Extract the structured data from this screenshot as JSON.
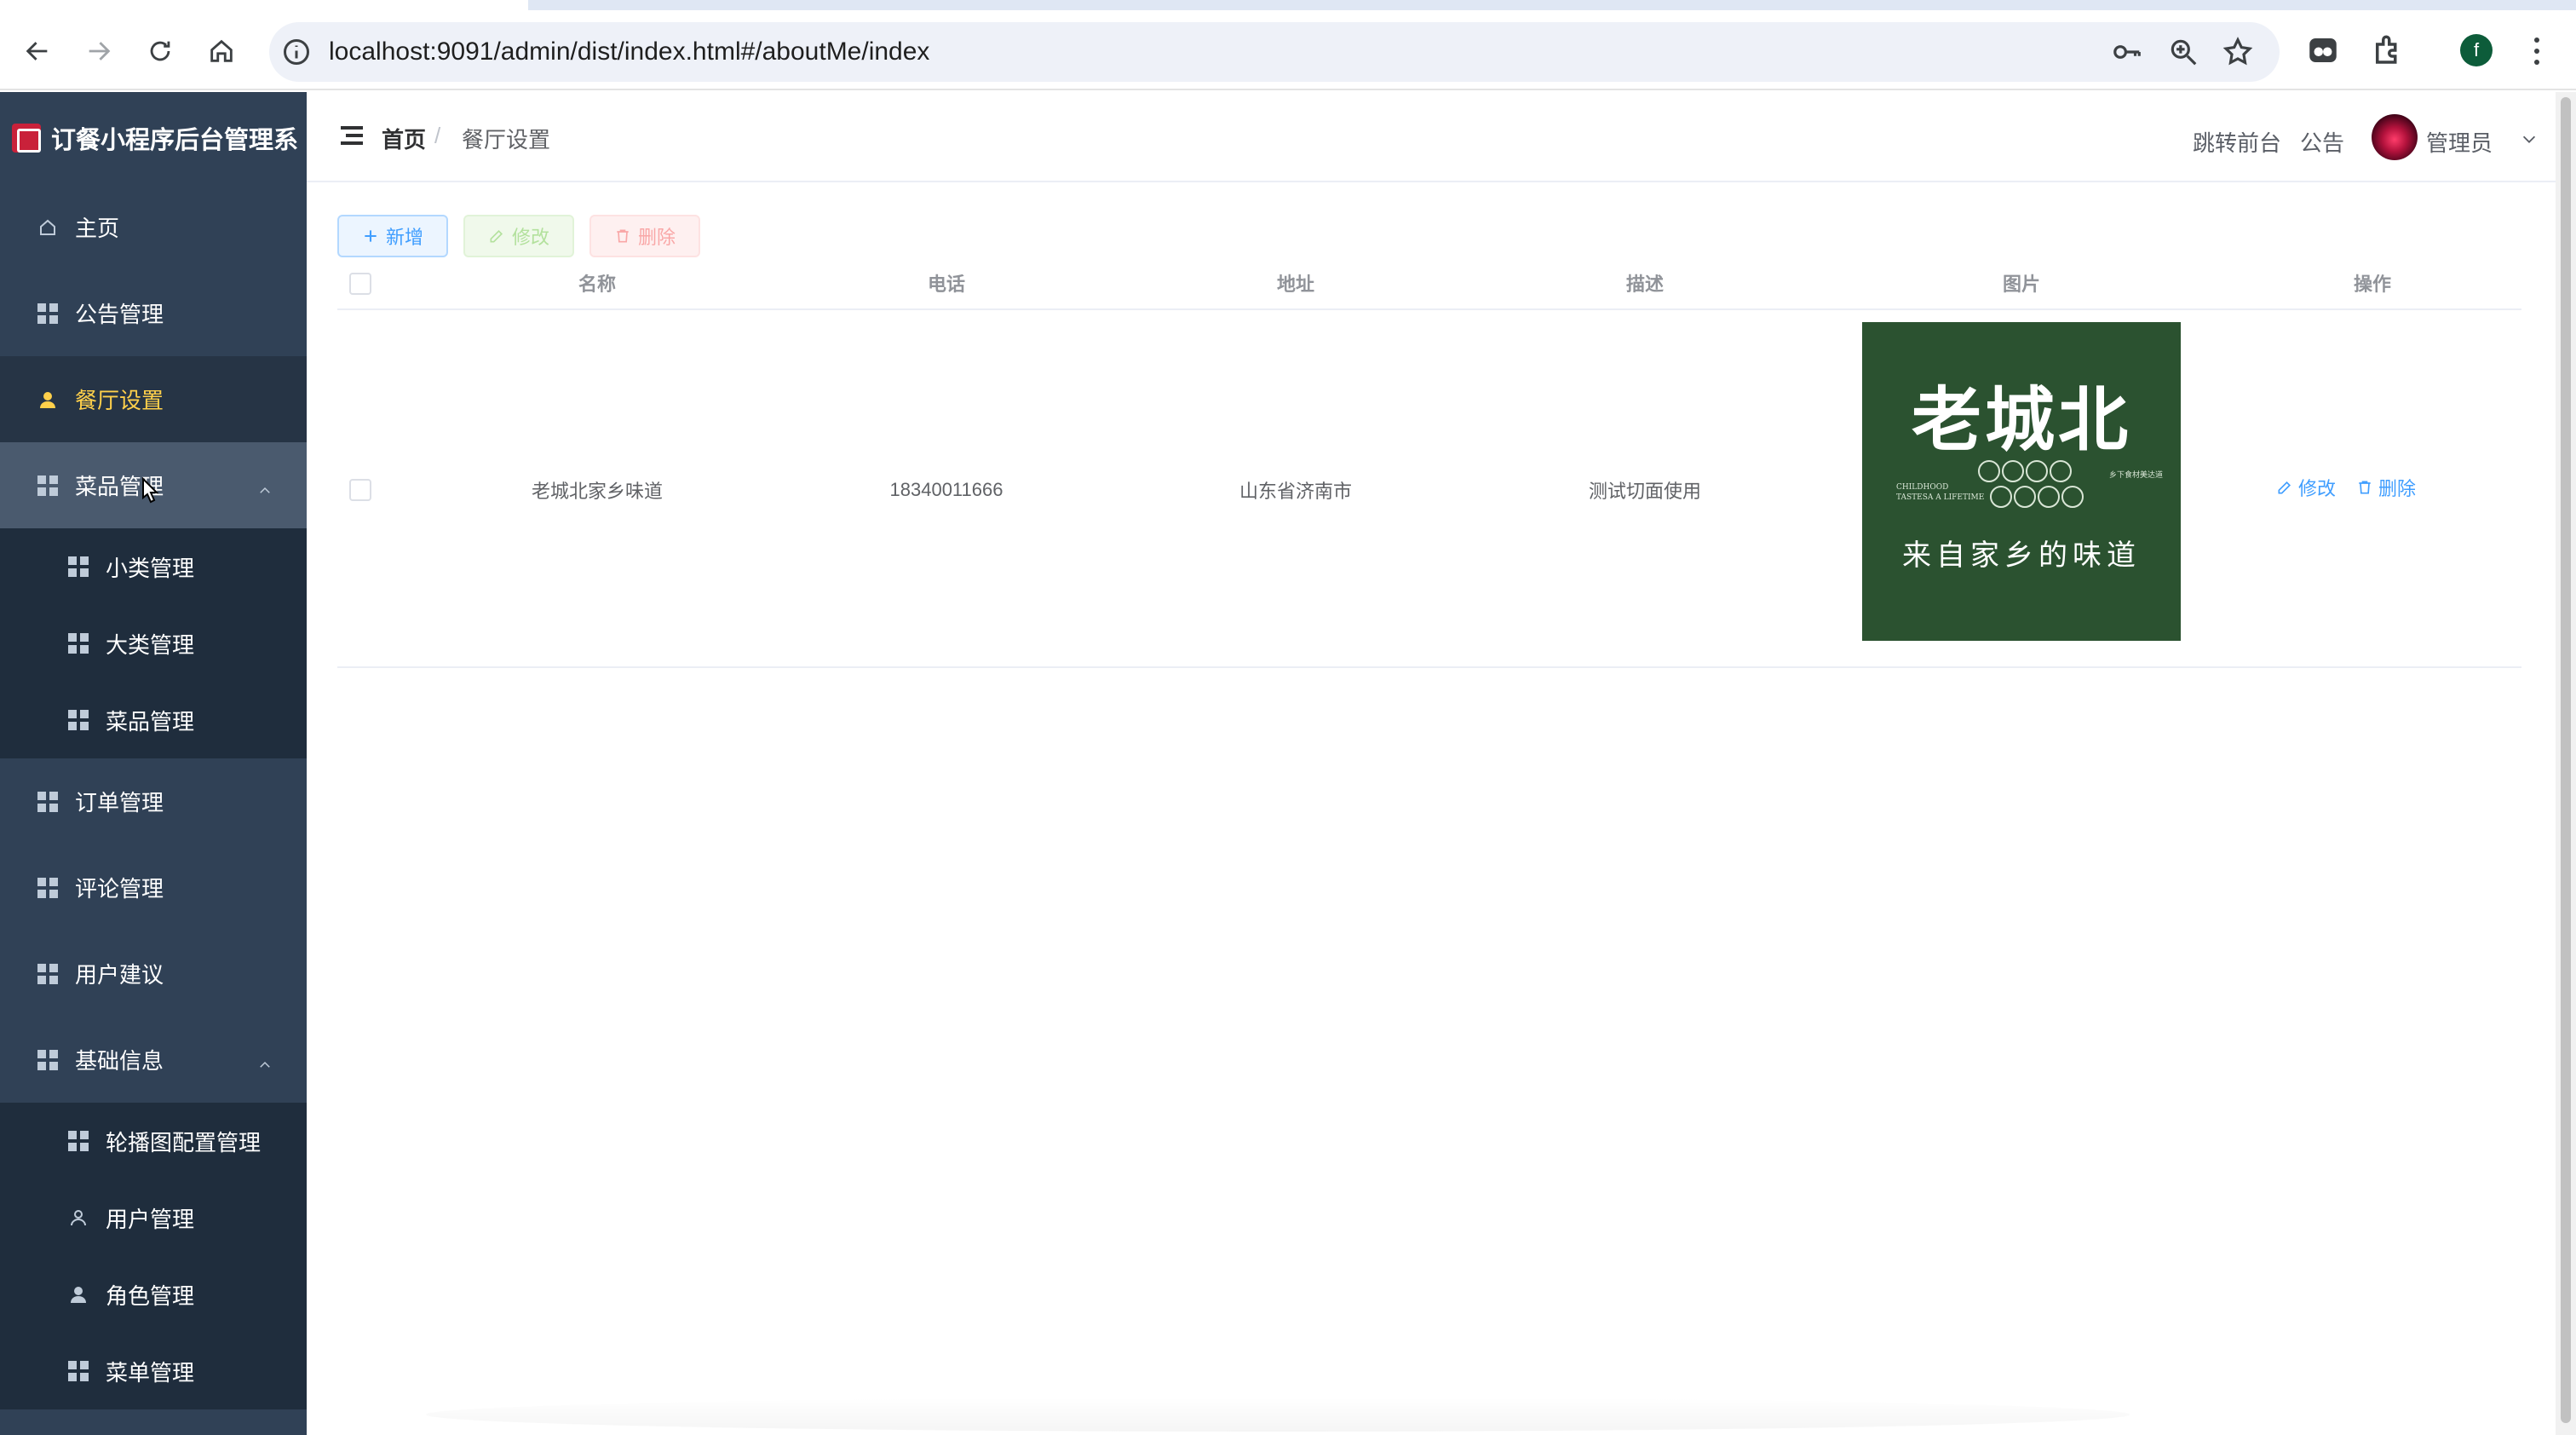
{
  "browser": {
    "url": "localhost:9091/admin/dist/index.html#/aboutMe/index",
    "profile_initial": "f"
  },
  "sidebar": {
    "title": "订餐小程序后台管理系",
    "items": [
      {
        "label": "主页",
        "icon": "home-icon"
      },
      {
        "label": "公告管理",
        "icon": "grid-icon"
      },
      {
        "label": "餐厅设置",
        "icon": "user-icon",
        "active": true
      },
      {
        "label": "菜品管理",
        "icon": "grid-icon",
        "expanded": true
      },
      {
        "label": "小类管理",
        "icon": "grid-icon"
      },
      {
        "label": "大类管理",
        "icon": "grid-icon"
      },
      {
        "label": "菜品管理",
        "icon": "grid-icon"
      },
      {
        "label": "订单管理",
        "icon": "grid-icon"
      },
      {
        "label": "评论管理",
        "icon": "grid-icon"
      },
      {
        "label": "用户建议",
        "icon": "grid-icon"
      },
      {
        "label": "基础信息",
        "icon": "grid-icon",
        "expanded": true
      },
      {
        "label": "轮播图配置管理",
        "icon": "grid-icon"
      },
      {
        "label": "用户管理",
        "icon": "user-outline-icon"
      },
      {
        "label": "角色管理",
        "icon": "user-icon"
      },
      {
        "label": "菜单管理",
        "icon": "grid-icon"
      }
    ]
  },
  "header": {
    "breadcrumb_home": "首页",
    "breadcrumb_sep": "/",
    "breadcrumb_current": "餐厅设置",
    "link_frontend": "跳转前台",
    "link_notice": "公告",
    "user_name": "管理员"
  },
  "toolbar": {
    "add_label": "新增",
    "edit_label": "修改",
    "delete_label": "删除"
  },
  "table": {
    "columns": [
      "名称",
      "电话",
      "地址",
      "描述",
      "图片",
      "操作"
    ],
    "rows": [
      {
        "name": "老城北家乡味道",
        "phone": "18340011666",
        "address": "山东省济南市",
        "description": "测试切面使用",
        "image": {
          "title": "老城北",
          "subtitle": "来自家乡的味道",
          "english_1": "CHILDHOOD",
          "english_2": "TASTESA A LIFETIME",
          "small_text": "乡下食材美达道"
        },
        "action_edit": "修改",
        "action_delete": "删除"
      }
    ]
  },
  "colors": {
    "sidebar_bg": "#304156",
    "active_text": "#ffd04b",
    "primary": "#409eff",
    "image_bg": "#2b5230"
  }
}
